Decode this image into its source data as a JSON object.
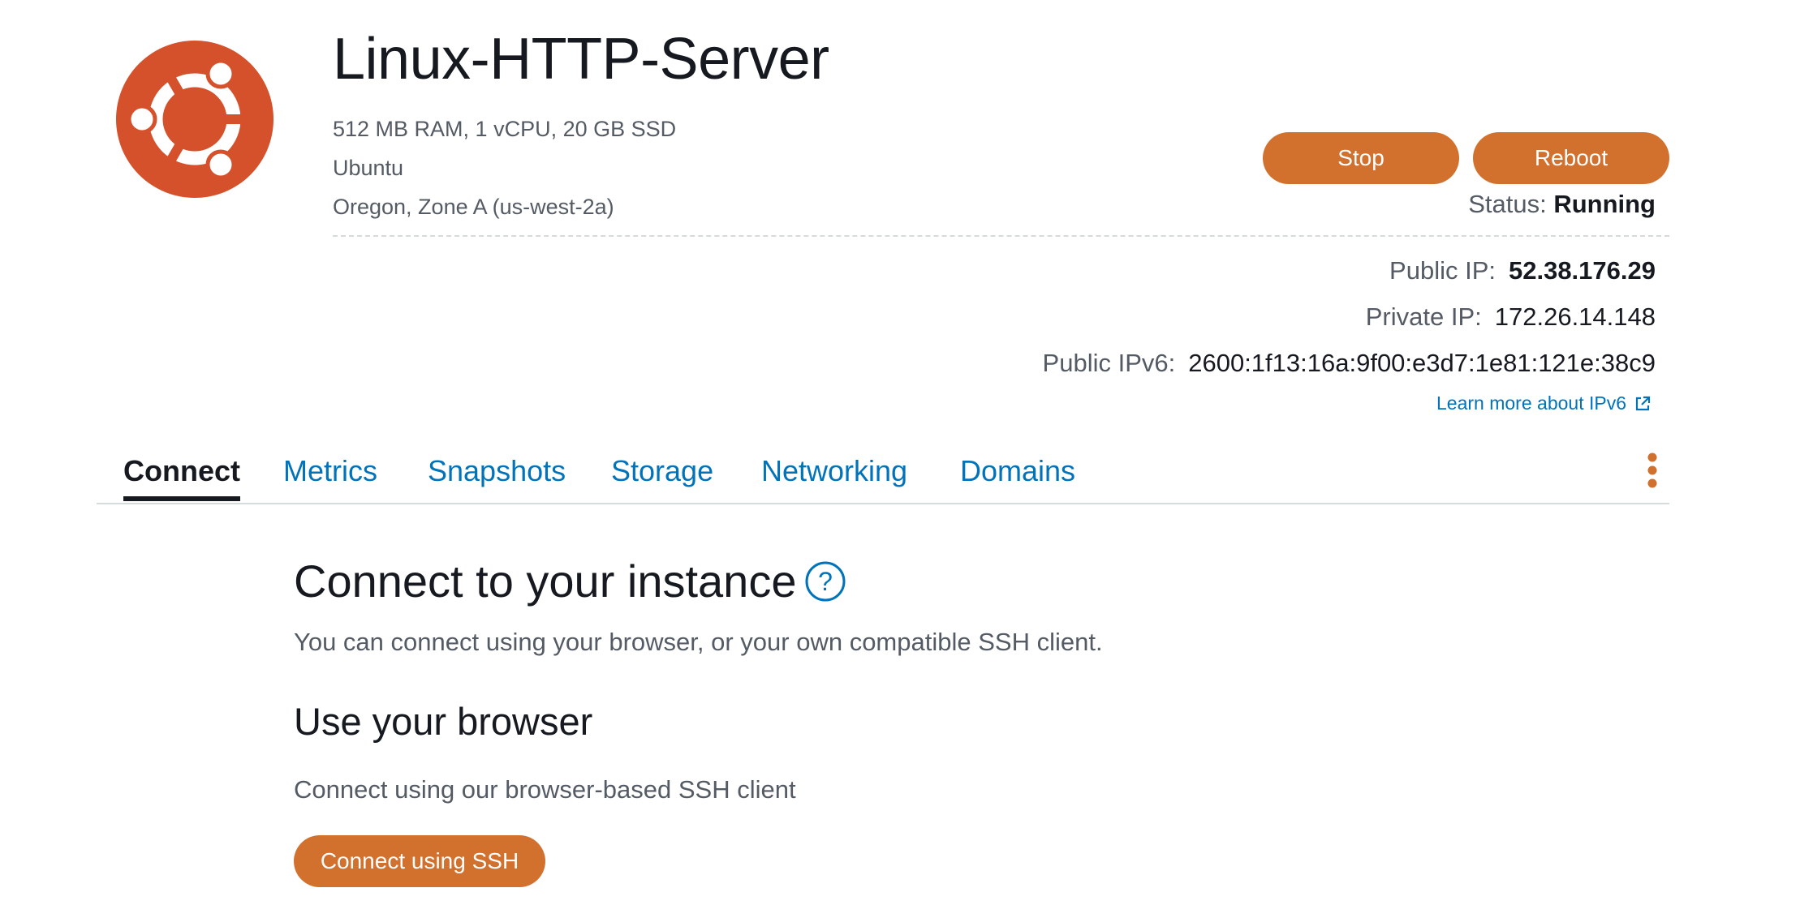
{
  "instance": {
    "name": "Linux-HTTP-Server",
    "specs": "512 MB RAM, 1 vCPU, 20 GB SSD",
    "os": "Ubuntu",
    "region": "Oregon, Zone A (us-west-2a)",
    "logo_icon": "ubuntu-logo-icon"
  },
  "actions": {
    "stop_label": "Stop",
    "reboot_label": "Reboot"
  },
  "status": {
    "label": "Status:",
    "value": "Running"
  },
  "network": {
    "public_ip_label": "Public IP:",
    "public_ip": "52.38.176.29",
    "private_ip_label": "Private IP:",
    "private_ip": "172.26.14.148",
    "public_ipv6_label": "Public IPv6:",
    "public_ipv6": "2600:1f13:16a:9f00:e3d7:1e81:121e:38c9",
    "learn_more": "Learn more about IPv6",
    "learn_more_icon": "external-link-icon"
  },
  "tabs": [
    {
      "label": "Connect",
      "active": true
    },
    {
      "label": "Metrics",
      "active": false
    },
    {
      "label": "Snapshots",
      "active": false
    },
    {
      "label": "Storage",
      "active": false
    },
    {
      "label": "Networking",
      "active": false
    },
    {
      "label": "Domains",
      "active": false
    }
  ],
  "connect": {
    "title": "Connect to your instance",
    "help_icon": "question-circle-icon",
    "description": "You can connect using your browser, or your own compatible SSH client.",
    "browser_title": "Use your browser",
    "browser_description": "Connect using our browser-based SSH client",
    "ssh_button": "Connect using SSH"
  },
  "colors": {
    "accent": "#d2702d",
    "ubuntu": "#d5512b",
    "link": "#0073bb",
    "text": "#16191f",
    "muted": "#545b64"
  }
}
